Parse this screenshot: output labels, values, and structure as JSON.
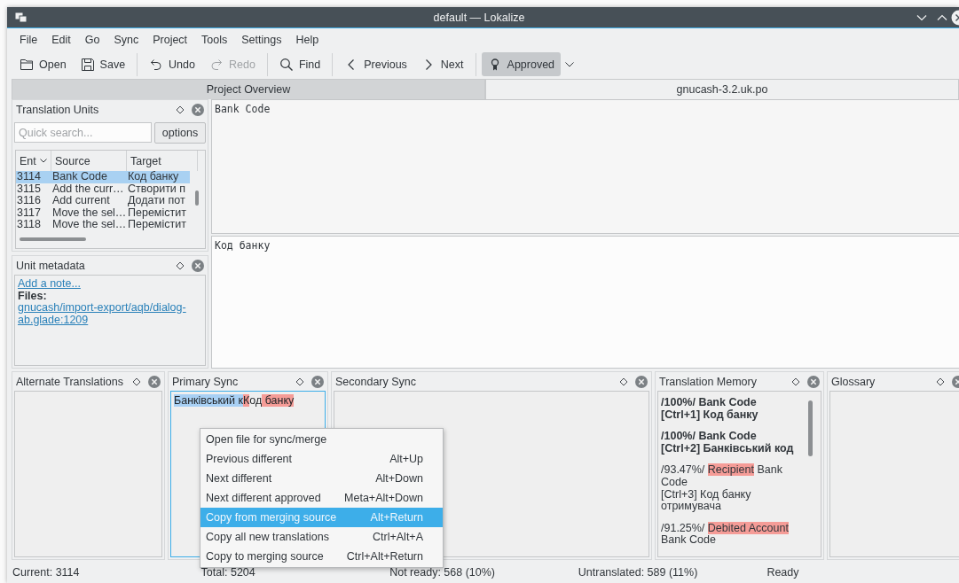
{
  "window": {
    "title": "default — Lokalize"
  },
  "menu_bar": [
    "File",
    "Edit",
    "Go",
    "Sync",
    "Project",
    "Tools",
    "Settings",
    "Help"
  ],
  "toolbar": {
    "groups": [
      [
        {
          "label": "Open",
          "kind": "action",
          "disabled": false
        },
        {
          "label": "Save",
          "kind": "action",
          "disabled": false
        }
      ],
      [
        {
          "label": "Undo",
          "kind": "action",
          "disabled": false
        },
        {
          "label": "Redo",
          "kind": "action",
          "disabled": true
        }
      ],
      [
        {
          "label": "Find",
          "kind": "action",
          "disabled": false
        }
      ],
      [
        {
          "label": "Previous",
          "kind": "action",
          "disabled": false
        },
        {
          "label": "Next",
          "kind": "action",
          "disabled": false
        }
      ],
      [
        {
          "label": "Approved",
          "kind": "toggle",
          "disabled": false,
          "checked": true
        }
      ]
    ]
  },
  "tabs": [
    {
      "label": "Project Overview",
      "selected": false
    },
    {
      "label": "gnucash-3.2.uk.po",
      "selected": true
    }
  ],
  "translation_units": {
    "title": "Translation Units",
    "search": {
      "placeholder": "Quick search..."
    },
    "options_button": "options",
    "columns": [
      "Ent",
      "Source",
      "Target"
    ],
    "rows": [
      {
        "cells": [
          "3114",
          "Bank Code",
          "Код банку"
        ],
        "selected": true
      },
      {
        "cells": [
          "3115",
          "Add the curr…",
          "Створити п"
        ],
        "selected": false
      },
      {
        "cells": [
          "3116",
          "Add current",
          "Додати пот"
        ],
        "selected": false
      },
      {
        "cells": [
          "3117",
          "Move the sel…",
          "Перемістит"
        ],
        "selected": false
      },
      {
        "cells": [
          "3118",
          "Move the sel…",
          "Перемістит"
        ],
        "selected": false
      }
    ]
  },
  "unit_metadata": {
    "title": "Unit metadata",
    "note_link": "Add a note...",
    "files_label": "Files:",
    "file_link": "gnucash/import-export/aqb/dialog-ab.glade:1209"
  },
  "source_editor": {
    "text": "Bank Code"
  },
  "target_editor": {
    "text": "Код банку"
  },
  "docks": [
    {
      "title": "Alternate Translations",
      "kind": "empty",
      "focused": false
    },
    {
      "title": "Primary Sync",
      "kind": "text",
      "focused": true,
      "segments": [
        {
          "text": "Банківський к",
          "color": "#a8d0f4"
        },
        {
          "text": "К",
          "color": "#f59c97"
        },
        {
          "text": "од"
        },
        {
          "text": " банку",
          "color": "#f59c97"
        }
      ]
    },
    {
      "title": "Secondary Sync",
      "kind": "empty",
      "focused": false
    },
    {
      "title": "Translation Memory",
      "kind": "memory",
      "focused": false,
      "entries": [
        {
          "bold": true,
          "source": [
            {
              "text": "/100%/ Bank Code"
            }
          ],
          "target": "[Ctrl+1] Код банку"
        },
        {
          "bold": true,
          "source": [
            {
              "text": "/100%/ Bank Code"
            }
          ],
          "target": "[Ctrl+2] Банківський код"
        },
        {
          "bold": false,
          "source": [
            {
              "text": "/93.47%/ "
            },
            {
              "text": "Recipient",
              "color": "#f59c97"
            },
            {
              "text": " Bank Code"
            }
          ],
          "target": "[Ctrl+3] Код банку отримувача"
        },
        {
          "bold": false,
          "source": [
            {
              "text": "/91.25%/ "
            },
            {
              "text": "Debited Account",
              "color": "#f59c97"
            },
            {
              "text": " Bank Code"
            }
          ]
        }
      ]
    },
    {
      "title": "Glossary",
      "kind": "empty",
      "focused": false
    }
  ],
  "context_menu": {
    "items": [
      {
        "label": "Open file for sync/merge",
        "selected": false
      },
      {
        "label": "Previous different",
        "shortcut": "Alt+Up",
        "selected": false
      },
      {
        "label": "Next different",
        "shortcut": "Alt+Down",
        "selected": false
      },
      {
        "label": "Next different approved",
        "shortcut": "Meta+Alt+Down",
        "selected": false
      },
      {
        "label": "Copy from merging source",
        "shortcut": "Alt+Return",
        "selected": true
      },
      {
        "label": "Copy all new translations",
        "shortcut": "Ctrl+Alt+A",
        "selected": false
      },
      {
        "label": "Copy to merging source",
        "shortcut": "Ctrl+Alt+Return",
        "selected": false
      }
    ]
  },
  "status_bar": [
    "Current: 3114",
    "Total: 5204",
    "Not ready: 568 (10%)",
    "Untranslated: 589 (11%)",
    "Ready"
  ]
}
